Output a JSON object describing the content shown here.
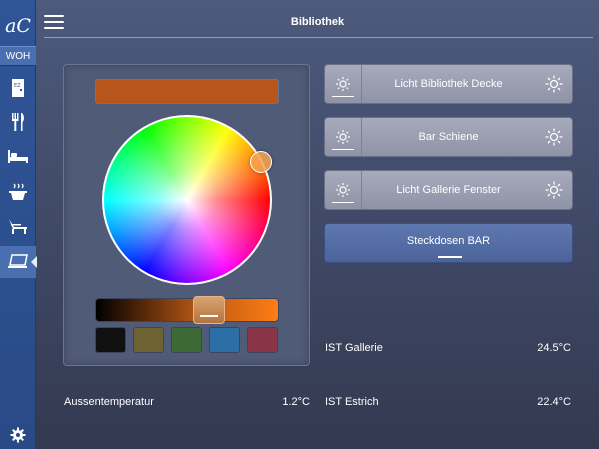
{
  "app": {
    "logo_text": "aC",
    "room_tag": "WOH"
  },
  "sidebar": {
    "items": [
      {
        "icon": "door-icon",
        "active": false
      },
      {
        "icon": "fork-knife-icon",
        "active": false
      },
      {
        "icon": "bed-icon",
        "active": false
      },
      {
        "icon": "steaming-pot-icon",
        "active": false
      },
      {
        "icon": "lounge-chair-icon",
        "active": false
      },
      {
        "icon": "laptop-icon",
        "active": true
      }
    ],
    "settings_icon": "gear-icon"
  },
  "header": {
    "title": "Bibliothek",
    "menu_icon": "hamburger-icon"
  },
  "color_control": {
    "current_color": "#b8551a",
    "brightness_fraction": 0.62,
    "presets": [
      "#111111",
      "#6e6232",
      "#3d6a34",
      "#2c6fa6",
      "#8a3448"
    ]
  },
  "lights": [
    {
      "label": "Licht Bibliothek Decke",
      "left_icon": "sun-dim-icon",
      "right_icon": "sun-bright-icon"
    },
    {
      "label": "Bar Schiene",
      "left_icon": "sun-dim-icon",
      "right_icon": "sun-bright-icon"
    },
    {
      "label": "Licht Gallerie Fenster",
      "left_icon": "sun-dim-icon",
      "right_icon": "sun-bright-icon"
    }
  ],
  "outlet": {
    "label": "Steckdosen BAR",
    "on": true
  },
  "readouts": {
    "outside_label": "Aussentemperatur",
    "outside_value": "1.2°C",
    "gallerie_label": "IST Gallerie",
    "gallerie_value": "24.5°C",
    "estrich_label": "IST Estrich",
    "estrich_value": "22.4°C"
  }
}
